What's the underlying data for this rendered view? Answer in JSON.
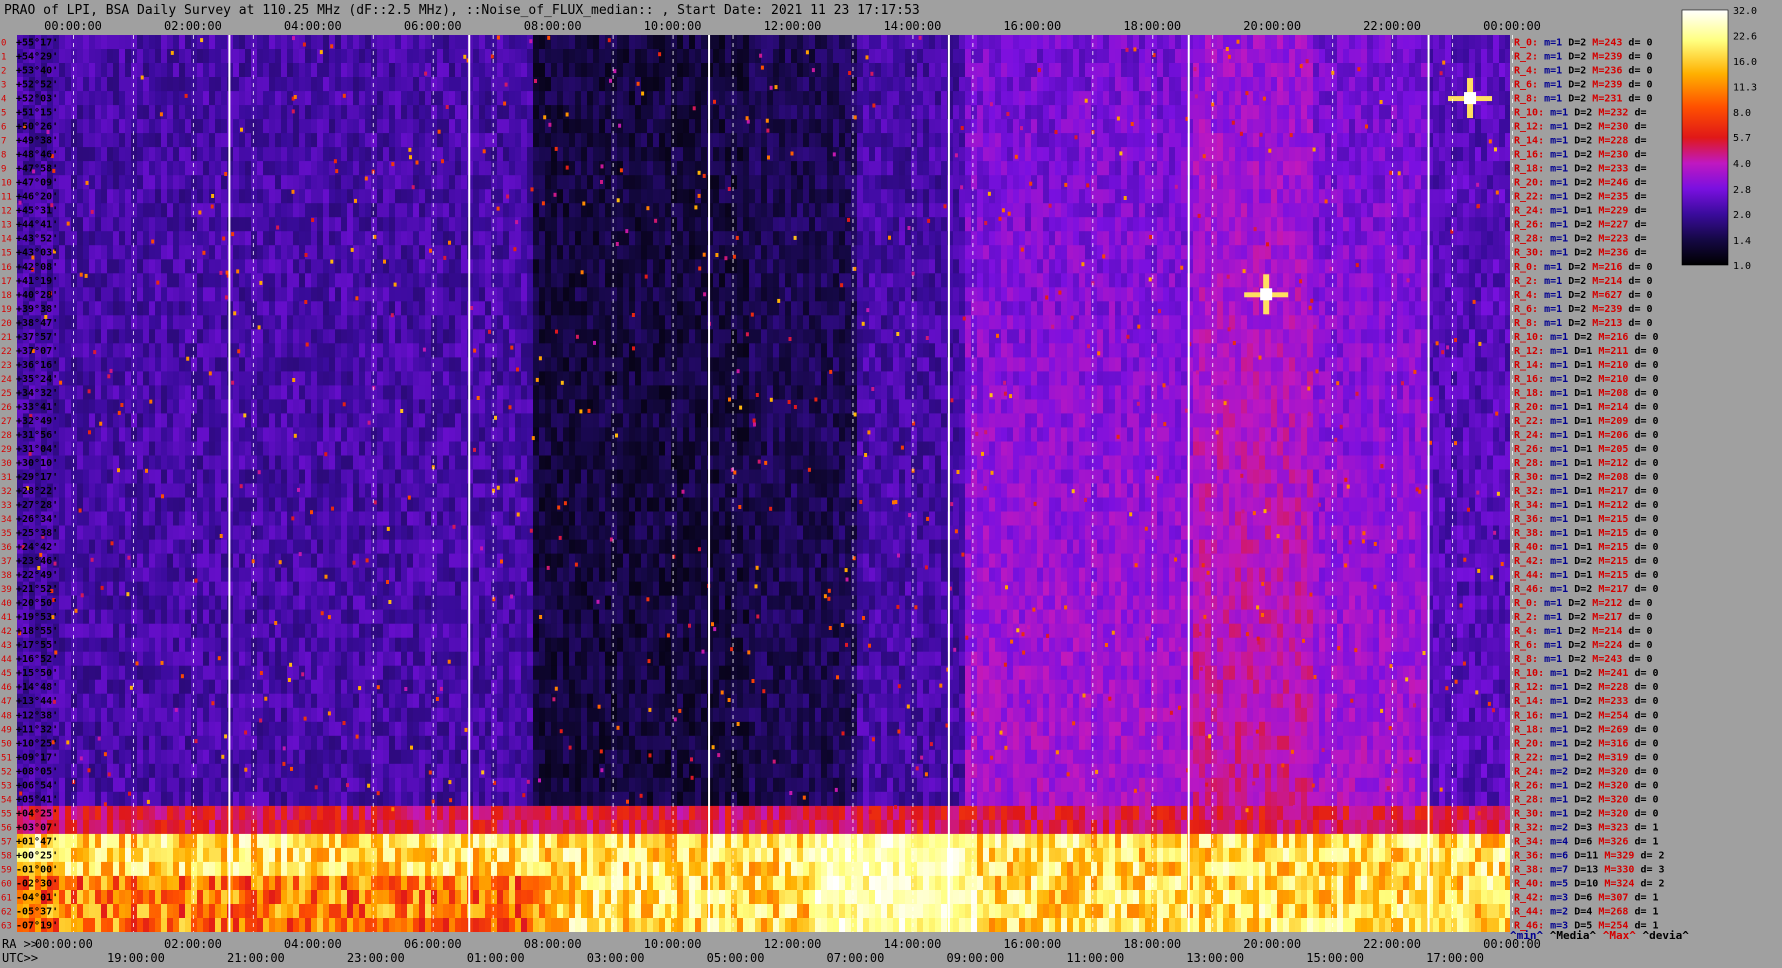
{
  "title": "PRAO of LPI, BSA Daily Survey at 110.25 MHz (dF::2.5 MHz), ::Noise_of_FLUX_median:: , Start Date: 2021 11 23 17:17:53",
  "colors": {
    "background": "#a0a0a0",
    "stat_red": "#d40000",
    "stat_blue": "#000090",
    "stat_black": "#000000",
    "colormap": [
      "#000000",
      "#150845",
      "#3a0b9c",
      "#7a10e0",
      "#c018c0",
      "#e01818",
      "#ff5000",
      "#ffb000",
      "#ffff80",
      "#ffffff"
    ]
  },
  "chart_data": {
    "type": "heatmap",
    "title": "PRAO of LPI, BSA Daily Survey at 110.25 MHz (dF::2.5 MHz), ::Noise_of_FLUX_median:: , Start Date: 2021 11 23 17:17:53",
    "x_top_ticks": [
      "00:00:00",
      "02:00:00",
      "04:00:00",
      "06:00:00",
      "08:00:00",
      "10:00:00",
      "12:00:00",
      "14:00:00",
      "16:00:00",
      "18:00:00",
      "20:00:00",
      "22:00:00",
      "00:00:00"
    ],
    "x_bottom_ra_label": "RA >>",
    "x_bottom_ra_ticks": [
      "00:00:00",
      "02:00:00",
      "04:00:00",
      "06:00:00",
      "08:00:00",
      "10:00:00",
      "12:00:00",
      "14:00:00",
      "16:00:00",
      "18:00:00",
      "20:00:00",
      "22:00:00",
      "00:00:00"
    ],
    "x_bottom_utc_label": "UTC>>",
    "x_bottom_utc_ticks": [
      "19:00:00",
      "21:00:00",
      "23:00:00",
      "01:00:00",
      "03:00:00",
      "05:00:00",
      "07:00:00",
      "09:00:00",
      "11:00:00",
      "13:00:00",
      "15:00:00",
      "17:00:00"
    ],
    "y_declinations": [
      "+55°17'",
      "+54°29'",
      "+53°40'",
      "+52°52'",
      "+52°03'",
      "+51°15'",
      "+50°26'",
      "+49°38'",
      "+48°46'",
      "+47°58'",
      "+47°09'",
      "+46°20'",
      "+45°31'",
      "+44°41'",
      "+43°52'",
      "+43°03'",
      "+42°08'",
      "+41°19'",
      "+40°28'",
      "+39°38'",
      "+38°47'",
      "+37°57'",
      "+37°07'",
      "+36°16'",
      "+35°24'",
      "+34°32'",
      "+33°41'",
      "+32°49'",
      "+31°56'",
      "+31°04'",
      "+30°10'",
      "+29°17'",
      "+28°22'",
      "+27°28'",
      "+26°34'",
      "+25°38'",
      "+24°42'",
      "+23°46'",
      "+22°49'",
      "+21°52'",
      "+20°50'",
      "+19°53'",
      "+18°55'",
      "+17°55'",
      "+16°52'",
      "+15°50'",
      "+14°48'",
      "+13°44'",
      "+12°38'",
      "+11°32'",
      "+10°25'",
      "+09°17'",
      "+08°05'",
      "+06°54'",
      "+05°41'",
      "+04°25'",
      "+03°07'",
      "+01°47'",
      "+00°25'",
      "-01°00'",
      "-02°30'",
      "-04°01'",
      "-05°37'",
      "-07°19'"
    ],
    "colorbar": {
      "ticks": [
        "32.0",
        "22.6",
        "16.0",
        "11.3",
        "8.0",
        "5.7",
        "4.0",
        "2.8",
        "2.0",
        "1.4",
        "1.0"
      ],
      "scale": "log",
      "range": [
        1.0,
        32.0
      ]
    },
    "stats": [
      {
        "r": "R_0:",
        "m": "m=1",
        "D": "D=2",
        "M": "M=243",
        "d": "d= 0"
      },
      {
        "r": "R_2:",
        "m": "m=1",
        "D": "D=2",
        "M": "M=239",
        "d": "d= 0"
      },
      {
        "r": "R_4:",
        "m": "m=1",
        "D": "D=2",
        "M": "M=236",
        "d": "d= 0"
      },
      {
        "r": "R_6:",
        "m": "m=1",
        "D": "D=2",
        "M": "M=239",
        "d": "d= 0"
      },
      {
        "r": "R_8:",
        "m": "m=1",
        "D": "D=2",
        "M": "M=231",
        "d": "d= 0"
      },
      {
        "r": "R_10:",
        "m": "m=1",
        "D": "D=2",
        "M": "M=232",
        "d": "d="
      },
      {
        "r": "R_12:",
        "m": "m=1",
        "D": "D=2",
        "M": "M=230",
        "d": "d="
      },
      {
        "r": "R_14:",
        "m": "m=1",
        "D": "D=2",
        "M": "M=228",
        "d": "d="
      },
      {
        "r": "R_16:",
        "m": "m=1",
        "D": "D=2",
        "M": "M=230",
        "d": "d="
      },
      {
        "r": "R_18:",
        "m": "m=1",
        "D": "D=2",
        "M": "M=233",
        "d": "d="
      },
      {
        "r": "R_20:",
        "m": "m=1",
        "D": "D=2",
        "M": "M=246",
        "d": "d="
      },
      {
        "r": "R_22:",
        "m": "m=1",
        "D": "D=2",
        "M": "M=235",
        "d": "d="
      },
      {
        "r": "R_24:",
        "m": "m=1",
        "D": "D=1",
        "M": "M=229",
        "d": "d="
      },
      {
        "r": "R_26:",
        "m": "m=1",
        "D": "D=2",
        "M": "M=227",
        "d": "d="
      },
      {
        "r": "R_28:",
        "m": "m=1",
        "D": "D=2",
        "M": "M=223",
        "d": "d="
      },
      {
        "r": "R_30:",
        "m": "m=1",
        "D": "D=2",
        "M": "M=236",
        "d": "d="
      },
      {
        "r": "R_0:",
        "m": "m=1",
        "D": "D=2",
        "M": "M=216",
        "d": "d= 0"
      },
      {
        "r": "R_2:",
        "m": "m=1",
        "D": "D=2",
        "M": "M=214",
        "d": "d= 0"
      },
      {
        "r": "R_4:",
        "m": "m=1",
        "D": "D=2",
        "M": "M=627",
        "d": "d= 0"
      },
      {
        "r": "R_6:",
        "m": "m=1",
        "D": "D=2",
        "M": "M=239",
        "d": "d= 0"
      },
      {
        "r": "R_8:",
        "m": "m=1",
        "D": "D=2",
        "M": "M=213",
        "d": "d= 0"
      },
      {
        "r": "R_10:",
        "m": "m=1",
        "D": "D=2",
        "M": "M=216",
        "d": "d= 0"
      },
      {
        "r": "R_12:",
        "m": "m=1",
        "D": "D=1",
        "M": "M=211",
        "d": "d= 0"
      },
      {
        "r": "R_14:",
        "m": "m=1",
        "D": "D=1",
        "M": "M=210",
        "d": "d= 0"
      },
      {
        "r": "R_16:",
        "m": "m=1",
        "D": "D=2",
        "M": "M=210",
        "d": "d= 0"
      },
      {
        "r": "R_18:",
        "m": "m=1",
        "D": "D=1",
        "M": "M=208",
        "d": "d= 0"
      },
      {
        "r": "R_20:",
        "m": "m=1",
        "D": "D=1",
        "M": "M=214",
        "d": "d= 0"
      },
      {
        "r": "R_22:",
        "m": "m=1",
        "D": "D=1",
        "M": "M=209",
        "d": "d= 0"
      },
      {
        "r": "R_24:",
        "m": "m=1",
        "D": "D=1",
        "M": "M=206",
        "d": "d= 0"
      },
      {
        "r": "R_26:",
        "m": "m=1",
        "D": "D=1",
        "M": "M=205",
        "d": "d= 0"
      },
      {
        "r": "R_28:",
        "m": "m=1",
        "D": "D=1",
        "M": "M=212",
        "d": "d= 0"
      },
      {
        "r": "R_30:",
        "m": "m=1",
        "D": "D=2",
        "M": "M=208",
        "d": "d= 0"
      },
      {
        "r": "R_32:",
        "m": "m=1",
        "D": "D=1",
        "M": "M=217",
        "d": "d= 0"
      },
      {
        "r": "R_34:",
        "m": "m=1",
        "D": "D=1",
        "M": "M=212",
        "d": "d= 0"
      },
      {
        "r": "R_36:",
        "m": "m=1",
        "D": "D=1",
        "M": "M=215",
        "d": "d= 0"
      },
      {
        "r": "R_38:",
        "m": "m=1",
        "D": "D=1",
        "M": "M=215",
        "d": "d= 0"
      },
      {
        "r": "R_40:",
        "m": "m=1",
        "D": "D=1",
        "M": "M=215",
        "d": "d= 0"
      },
      {
        "r": "R_42:",
        "m": "m=1",
        "D": "D=2",
        "M": "M=215",
        "d": "d= 0"
      },
      {
        "r": "R_44:",
        "m": "m=1",
        "D": "D=1",
        "M": "M=215",
        "d": "d= 0"
      },
      {
        "r": "R_46:",
        "m": "m=1",
        "D": "D=2",
        "M": "M=217",
        "d": "d= 0"
      },
      {
        "r": "R_0:",
        "m": "m=1",
        "D": "D=2",
        "M": "M=212",
        "d": "d= 0"
      },
      {
        "r": "R_2:",
        "m": "m=1",
        "D": "D=2",
        "M": "M=217",
        "d": "d= 0"
      },
      {
        "r": "R_4:",
        "m": "m=1",
        "D": "D=2",
        "M": "M=214",
        "d": "d= 0"
      },
      {
        "r": "R_6:",
        "m": "m=1",
        "D": "D=2",
        "M": "M=224",
        "d": "d= 0"
      },
      {
        "r": "R_8:",
        "m": "m=1",
        "D": "D=2",
        "M": "M=243",
        "d": "d= 0"
      },
      {
        "r": "R_10:",
        "m": "m=1",
        "D": "D=2",
        "M": "M=241",
        "d": "d= 0"
      },
      {
        "r": "R_12:",
        "m": "m=1",
        "D": "D=2",
        "M": "M=228",
        "d": "d= 0"
      },
      {
        "r": "R_14:",
        "m": "m=1",
        "D": "D=2",
        "M": "M=233",
        "d": "d= 0"
      },
      {
        "r": "R_16:",
        "m": "m=1",
        "D": "D=2",
        "M": "M=254",
        "d": "d= 0"
      },
      {
        "r": "R_18:",
        "m": "m=1",
        "D": "D=2",
        "M": "M=269",
        "d": "d= 0"
      },
      {
        "r": "R_20:",
        "m": "m=1",
        "D": "D=2",
        "M": "M=316",
        "d": "d= 0"
      },
      {
        "r": "R_22:",
        "m": "m=1",
        "D": "D=2",
        "M": "M=319",
        "d": "d= 0"
      },
      {
        "r": "R_24:",
        "m": "m=2",
        "D": "D=2",
        "M": "M=320",
        "d": "d= 0"
      },
      {
        "r": "R_26:",
        "m": "m=1",
        "D": "D=2",
        "M": "M=320",
        "d": "d= 0"
      },
      {
        "r": "R_28:",
        "m": "m=1",
        "D": "D=2",
        "M": "M=320",
        "d": "d= 0"
      },
      {
        "r": "R_30:",
        "m": "m=1",
        "D": "D=2",
        "M": "M=320",
        "d": "d= 0"
      },
      {
        "r": "R_32:",
        "m": "m=2",
        "D": "D=3",
        "M": "M=323",
        "d": "d= 1"
      },
      {
        "r": "R_34:",
        "m": "m=4",
        "D": "D=6",
        "M": "M=326",
        "d": "d= 1"
      },
      {
        "r": "R_36:",
        "m": "m=6",
        "D": "D=11",
        "M": "M=329",
        "d": "d= 2"
      },
      {
        "r": "R_38:",
        "m": "m=7",
        "D": "D=13",
        "M": "M=330",
        "d": "d= 3"
      },
      {
        "r": "R_40:",
        "m": "m=5",
        "D": "D=10",
        "M": "M=324",
        "d": "d= 2"
      },
      {
        "r": "R_42:",
        "m": "m=3",
        "D": "D=6",
        "M": "M=307",
        "d": "d= 1"
      },
      {
        "r": "R_44:",
        "m": "m=2",
        "D": "D=4",
        "M": "M=268",
        "d": "d= 1"
      },
      {
        "r": "R_46:",
        "m": "m=3",
        "D": "D=5",
        "M": "M=254",
        "d": "d= 1"
      }
    ],
    "stats_legend": [
      "^min^",
      "^Media^",
      "^Max^",
      "^devia^"
    ],
    "notable_sources": [
      {
        "ra_h": 19.9,
        "dec": 40.7,
        "desc": "bright source (Cyg A)"
      },
      {
        "ra_h": 23.3,
        "dec": 52.2,
        "desc": "bright source"
      }
    ]
  }
}
